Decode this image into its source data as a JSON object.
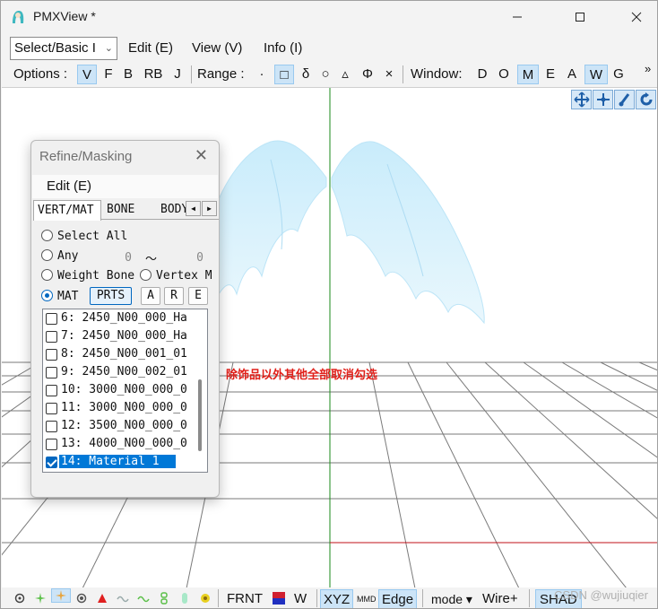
{
  "window": {
    "title": "PMXView *"
  },
  "menubar": {
    "mode_select": "Select/Basic I",
    "items": [
      "Edit (E)",
      "View (V)",
      "Info (I)"
    ]
  },
  "toolbar": {
    "options_label": "Options :",
    "options": [
      "V",
      "F",
      "B",
      "RB",
      "J"
    ],
    "options_selected": "V",
    "range_label": "Range :",
    "range_items": [
      "·",
      "□",
      "δ",
      "○",
      "▵",
      "Φ",
      "×"
    ],
    "range_selected": "□",
    "window_label": "Window:",
    "window_items": [
      "D",
      "O",
      "M",
      "E",
      "A",
      "W",
      "G"
    ],
    "window_selected": [
      "M",
      "W"
    ],
    "overflow": "»"
  },
  "nav_icons": [
    "move-all-icon",
    "move-icon",
    "rotate-axis-icon",
    "rotate-icon"
  ],
  "annotation": "除饰品以外其他全部取消勾选",
  "dialog": {
    "title": "Refine/Masking",
    "menu": "Edit (E)",
    "tabs": [
      "VERT/MAT",
      "BONE",
      "BODY"
    ],
    "active_tab": "VERT/MAT",
    "select_all": "Select All",
    "any_label": "Any",
    "any_from": "0",
    "tilde": "〜",
    "any_to": "0",
    "weight_bone": "Weight Bone",
    "vertex_m": "Vertex M",
    "mat_label": "MAT",
    "prts_button": "PRTS",
    "a_button": "A",
    "r_button": "R",
    "e_button": "E",
    "materials": [
      {
        "label": "6: 2450_N00_000_Ha",
        "checked": false
      },
      {
        "label": "7: 2450_N00_000_Ha",
        "checked": false
      },
      {
        "label": "8: 2450_N00_001_01",
        "checked": false
      },
      {
        "label": "9: 2450_N00_002_01",
        "checked": false
      },
      {
        "label": "10: 3000_N00_000_0",
        "checked": false
      },
      {
        "label": "11: 3000_N00_000_0",
        "checked": false
      },
      {
        "label": "12: 3500_N00_000_0",
        "checked": false
      },
      {
        "label": "13: 4000_N00_000_0",
        "checked": false
      },
      {
        "label": "14: Material 1",
        "checked": true
      }
    ]
  },
  "statusbar": {
    "frnt": "FRNT",
    "w": "W",
    "xyz": "XYZ",
    "mmd": "MMD",
    "edge": "Edge",
    "mode": "mode ▾",
    "wire": "Wire+",
    "shad": "SHAD",
    "watermark": "CSDN @wujiuqier"
  },
  "colors": {
    "accent": "#0078d7",
    "selected_bg": "#cce4f7",
    "annotation": "#e0201a",
    "wing": "#a9dcf5",
    "axis_green": "#1a8a1a",
    "axis_red": "#c0101a"
  }
}
